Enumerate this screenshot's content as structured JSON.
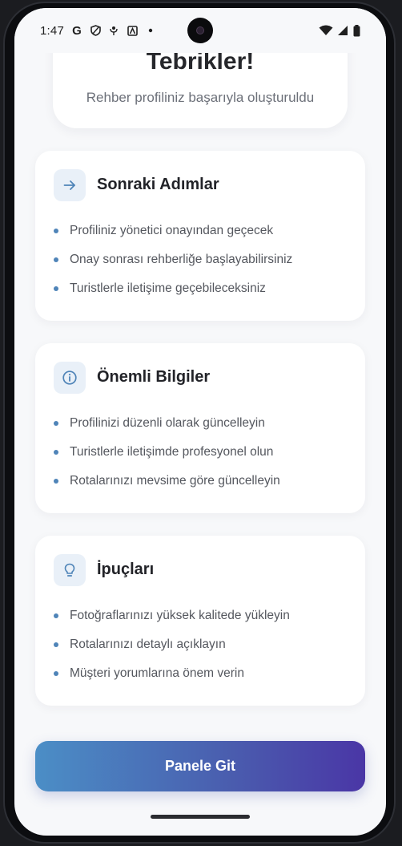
{
  "status_bar": {
    "time": "1:47",
    "left_icons": [
      "google-icon",
      "shield-icon",
      "podcast-icon",
      "news-icon",
      "dot-icon"
    ],
    "google_glyph": "G",
    "right_icons": [
      "wifi-icon",
      "signal-icon",
      "battery-icon"
    ]
  },
  "congrats": {
    "title": "Tebrikler!",
    "subtitle": "Rehber profiliniz başarıyla oluşturuldu"
  },
  "cards": [
    {
      "icon": "arrow-right-icon",
      "title": "Sonraki Adımlar",
      "items": [
        "Profiliniz yönetici onayından geçecek",
        "Onay sonrası rehberliğe başlayabilirsiniz",
        "Turistlerle iletişime geçebileceksiniz"
      ]
    },
    {
      "icon": "info-icon",
      "title": "Önemli Bilgiler",
      "items": [
        "Profilinizi düzenli olarak güncelleyin",
        "Turistlerle iletişimde profesyonel olun",
        "Rotalarınızı mevsime göre güncelleyin"
      ]
    },
    {
      "icon": "lightbulb-icon",
      "title": "İpuçları",
      "items": [
        "Fotoğraflarınızı yüksek kalitede yükleyin",
        "Rotalarınızı detaylı açıklayın",
        "Müşteri yorumlarına önem verin"
      ]
    }
  ],
  "cta": {
    "label": "Panele Git"
  },
  "colors": {
    "accent": "#4f84b8",
    "gradient_start": "#4b8ec6",
    "gradient_end": "#4a36a6",
    "icon_bg": "#e9f0f8"
  }
}
